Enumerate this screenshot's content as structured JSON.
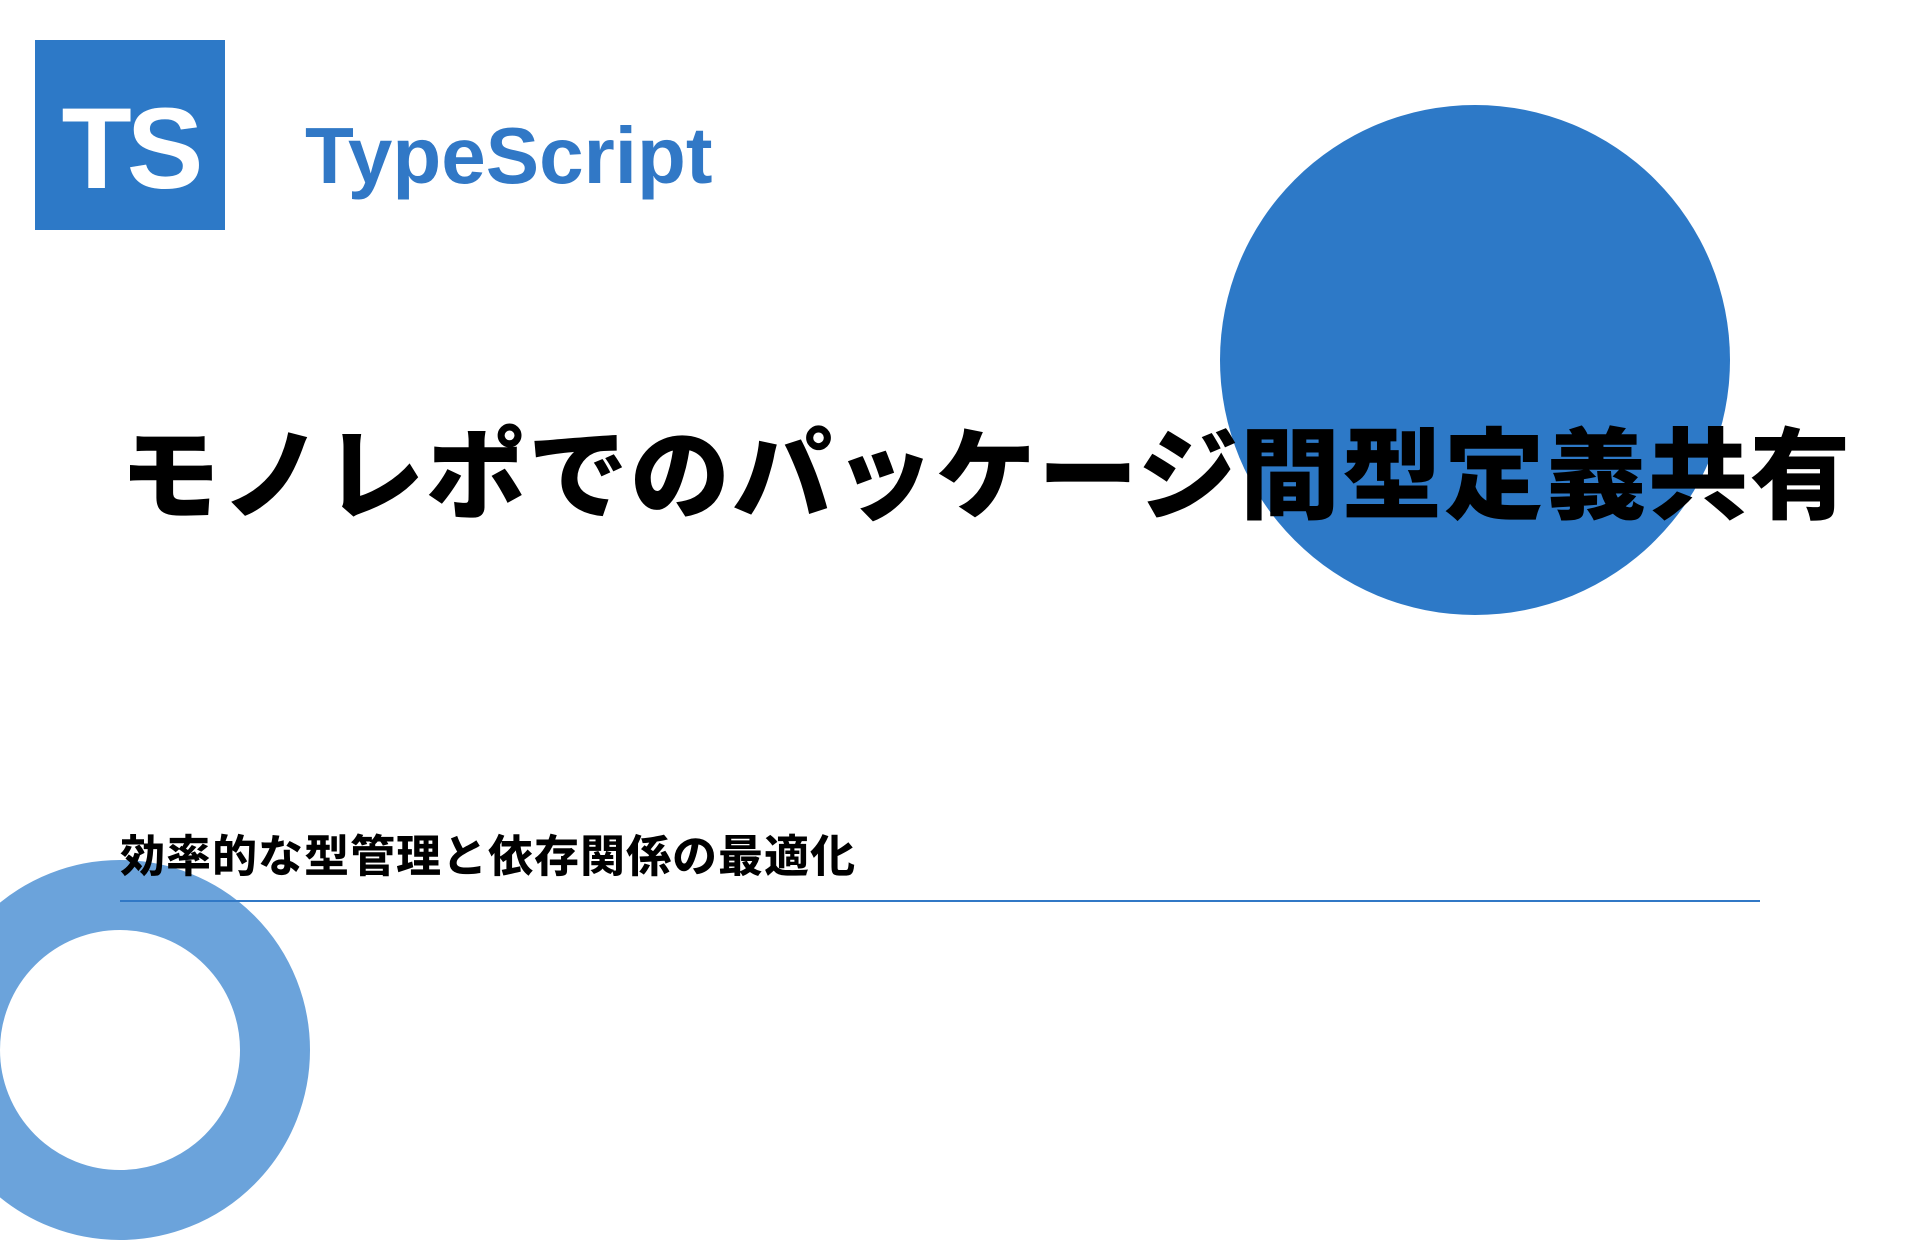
{
  "logo": {
    "text": "TS"
  },
  "brand": "TypeScript",
  "title": "モノレポでのパッケージ間型定義共有",
  "subtitle": "効率的な型管理と依存関係の最適化",
  "colors": {
    "primary": "#2d79c7",
    "accent": "#3178c6",
    "ring": "#6ba3db"
  }
}
